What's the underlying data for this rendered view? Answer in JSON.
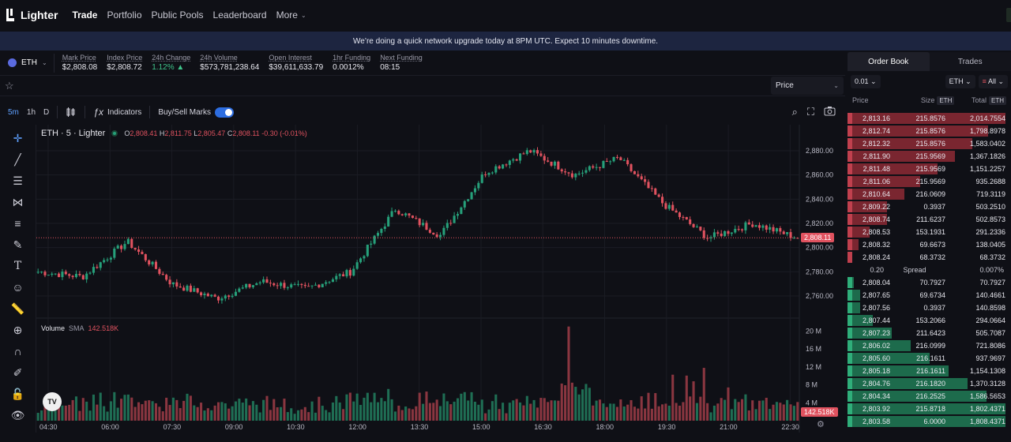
{
  "nav": {
    "brand": "Lighter",
    "items": [
      "Trade",
      "Portfolio",
      "Public Pools",
      "Leaderboard"
    ],
    "more": "More"
  },
  "banner": "We’re doing a quick network upgrade today at 8PM UTC. Expect 10 minutes downtime.",
  "market": {
    "symbol": "ETH",
    "stats": [
      {
        "label": "Mark Price",
        "value": "$2,808.08"
      },
      {
        "label": "Index Price",
        "value": "$2,808.72"
      },
      {
        "label": "24h Change",
        "value": "1.12% ▲"
      },
      {
        "label": "24h Volume",
        "value": "$573,781,238.64"
      },
      {
        "label": "Open Interest",
        "value": "$39,611,633.79"
      },
      {
        "label": "1hr Funding",
        "value": "0.0012%"
      },
      {
        "label": "Next Funding",
        "value": "08:15"
      }
    ],
    "price_select": "Price"
  },
  "toolbar": {
    "timeframes": [
      "5m",
      "1h",
      "D"
    ],
    "indicators": "Indicators",
    "buy_sell_marks": "Buy/Sell Marks"
  },
  "chart": {
    "legend_title": "ETH · 5 · Lighter",
    "o": "2,808.41",
    "h": "2,811.75",
    "l": "2,805.47",
    "c": "2,808.11",
    "chg": "-0.30 (-0.01%)",
    "volume_label": "Volume",
    "sma_label": "SMA",
    "sma_value": "142.518K",
    "last_price_tag": "2,808.11",
    "volume_tag": "142.518K",
    "price_ticks": [
      "2,880.00",
      "2,860.00",
      "2,840.00",
      "2,820.00",
      "2,800.00",
      "2,780.00",
      "2,760.00"
    ],
    "volume_ticks": [
      "20 M",
      "16 M",
      "12 M",
      "8 M",
      "4 M"
    ],
    "time_ticks": [
      "04:30",
      "06:00",
      "07:30",
      "09:00",
      "10:30",
      "12:00",
      "13:30",
      "15:00",
      "16:30",
      "18:00",
      "19:30",
      "21:00",
      "22:30"
    ],
    "colors": {
      "up": "#26a07a",
      "down": "#e0525f",
      "grid": "#1b1c24"
    }
  },
  "chart_data": {
    "type": "candlestick",
    "x_label_range": [
      "04:30",
      "22:30"
    ],
    "ylim": [
      2745,
      2895
    ],
    "key_levels": [
      2780,
      2776,
      2805,
      2770,
      2758,
      2772,
      2766,
      2780,
      2832,
      2810,
      2862,
      2880,
      2860,
      2874,
      2836,
      2808,
      2820,
      2808
    ],
    "volume_ylim": [
      0,
      22
    ],
    "volume_unit": "M",
    "last_close": 2808.11
  },
  "orderbook": {
    "tabs": [
      "Order Book",
      "Trades"
    ],
    "tick": "0.01",
    "asset": "ETH",
    "view": "All",
    "headers": {
      "price": "Price",
      "size": "Size",
      "total": "Total",
      "unit": "ETH"
    },
    "asks": [
      {
        "price": "2,813.16",
        "size": "215.8576",
        "total": "2,014.7554",
        "depth": 1.0
      },
      {
        "price": "2,812.74",
        "size": "215.8576",
        "total": "1,798.8978",
        "depth": 0.89
      },
      {
        "price": "2,812.32",
        "size": "215.8576",
        "total": "1,583.0402",
        "depth": 0.79
      },
      {
        "price": "2,811.90",
        "size": "215.9569",
        "total": "1,367.1826",
        "depth": 0.68
      },
      {
        "price": "2,811.48",
        "size": "215.9569",
        "total": "1,151.2257",
        "depth": 0.57
      },
      {
        "price": "2,811.06",
        "size": "215.9569",
        "total": "935.2688",
        "depth": 0.46
      },
      {
        "price": "2,810.64",
        "size": "216.0609",
        "total": "719.3119",
        "depth": 0.36
      },
      {
        "price": "2,809.22",
        "size": "0.3937",
        "total": "503.2510",
        "depth": 0.25
      },
      {
        "price": "2,808.74",
        "size": "211.6237",
        "total": "502.8573",
        "depth": 0.25
      },
      {
        "price": "2,808.53",
        "size": "153.1931",
        "total": "291.2336",
        "depth": 0.14
      },
      {
        "price": "2,808.32",
        "size": "69.6673",
        "total": "138.0405",
        "depth": 0.07
      },
      {
        "price": "2,808.24",
        "size": "68.3732",
        "total": "68.3732",
        "depth": 0.03
      }
    ],
    "spread": {
      "label": "Spread",
      "value": "0.20",
      "pct": "0.007%"
    },
    "bids": [
      {
        "price": "2,808.04",
        "size": "70.7927",
        "total": "70.7927",
        "depth": 0.04
      },
      {
        "price": "2,807.65",
        "size": "69.6734",
        "total": "140.4661",
        "depth": 0.08
      },
      {
        "price": "2,807.56",
        "size": "0.3937",
        "total": "140.8598",
        "depth": 0.08
      },
      {
        "price": "2,807.44",
        "size": "153.2066",
        "total": "294.0664",
        "depth": 0.16
      },
      {
        "price": "2,807.23",
        "size": "211.6423",
        "total": "505.7087",
        "depth": 0.28
      },
      {
        "price": "2,806.02",
        "size": "216.0999",
        "total": "721.8086",
        "depth": 0.4
      },
      {
        "price": "2,805.60",
        "size": "216.1611",
        "total": "937.9697",
        "depth": 0.52
      },
      {
        "price": "2,805.18",
        "size": "216.1611",
        "total": "1,154.1308",
        "depth": 0.64
      },
      {
        "price": "2,804.76",
        "size": "216.1820",
        "total": "1,370.3128",
        "depth": 0.76
      },
      {
        "price": "2,804.34",
        "size": "216.2525",
        "total": "1,586.5653",
        "depth": 0.88
      },
      {
        "price": "2,803.92",
        "size": "215.8718",
        "total": "1,802.4371",
        "depth": 1.0
      },
      {
        "price": "2,803.58",
        "size": "6.0000",
        "total": "1,808.4371",
        "depth": 1.0
      }
    ]
  }
}
